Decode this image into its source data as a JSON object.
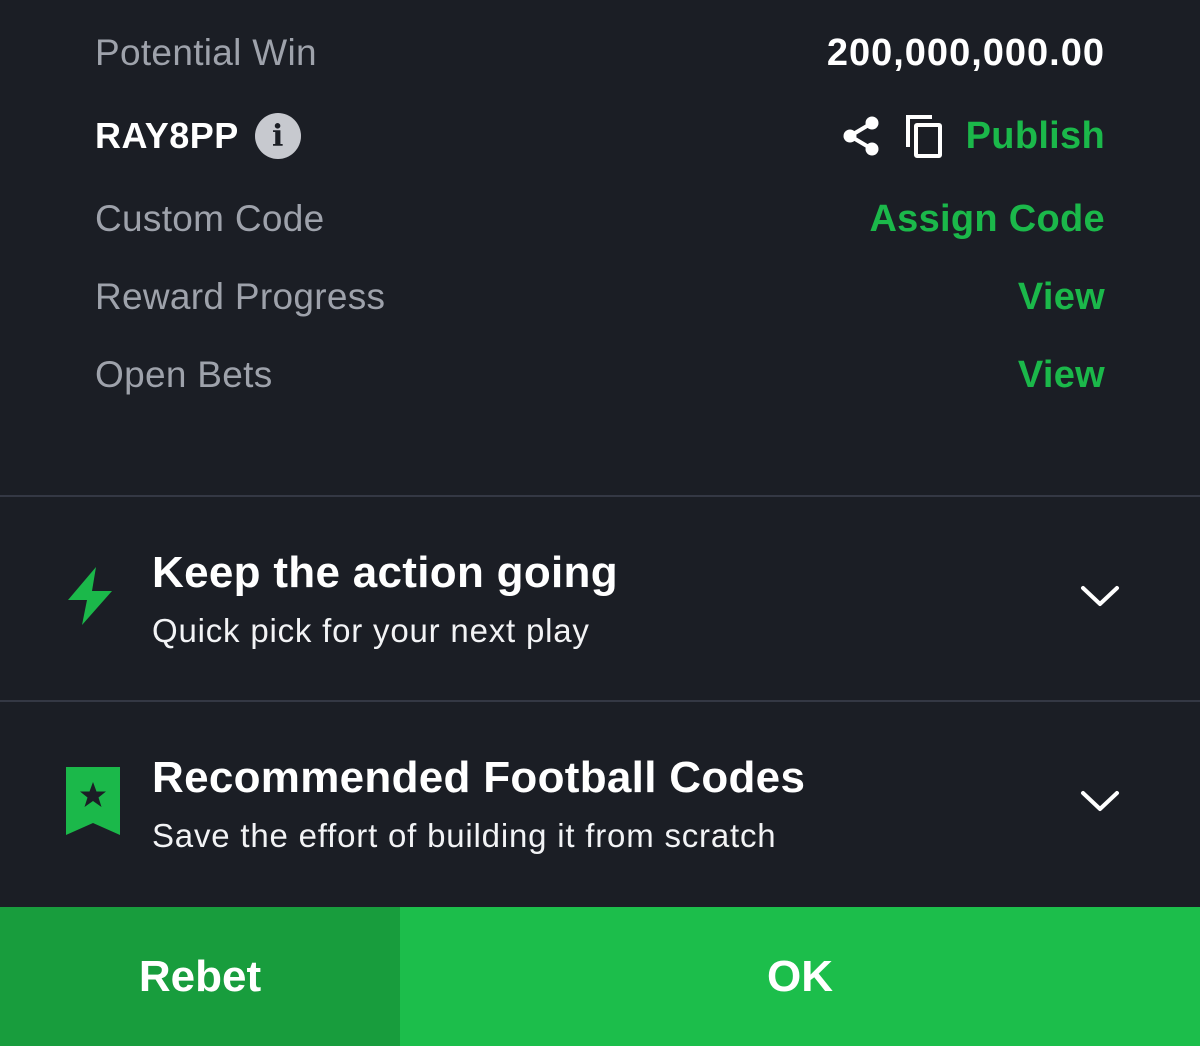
{
  "summary": {
    "potential_win_label": "Potential Win",
    "potential_win_value": "200,000,000.00",
    "booking_code": "RAY8PP",
    "info_glyph": "i",
    "publish_label": "Publish",
    "custom_code_label": "Custom Code",
    "assign_code_label": "Assign Code",
    "reward_progress_label": "Reward Progress",
    "reward_progress_link": "View",
    "open_bets_label": "Open Bets",
    "open_bets_link": "View"
  },
  "panels": [
    {
      "title": "Keep the action going",
      "subtitle": "Quick pick for your next play",
      "icon": "lightning-icon"
    },
    {
      "title": "Recommended Football Codes",
      "subtitle": "Save the effort of building it from scratch",
      "icon": "bookmark-star-icon"
    }
  ],
  "footer": {
    "rebet_label": "Rebet",
    "ok_label": "OK"
  },
  "colors": {
    "background": "#1b1e25",
    "accent_green": "#1bb84a",
    "rebet_button": "#189d3d",
    "ok_button": "#1cbe4b",
    "label_gray": "#9ea2ab",
    "divider": "#343844"
  }
}
